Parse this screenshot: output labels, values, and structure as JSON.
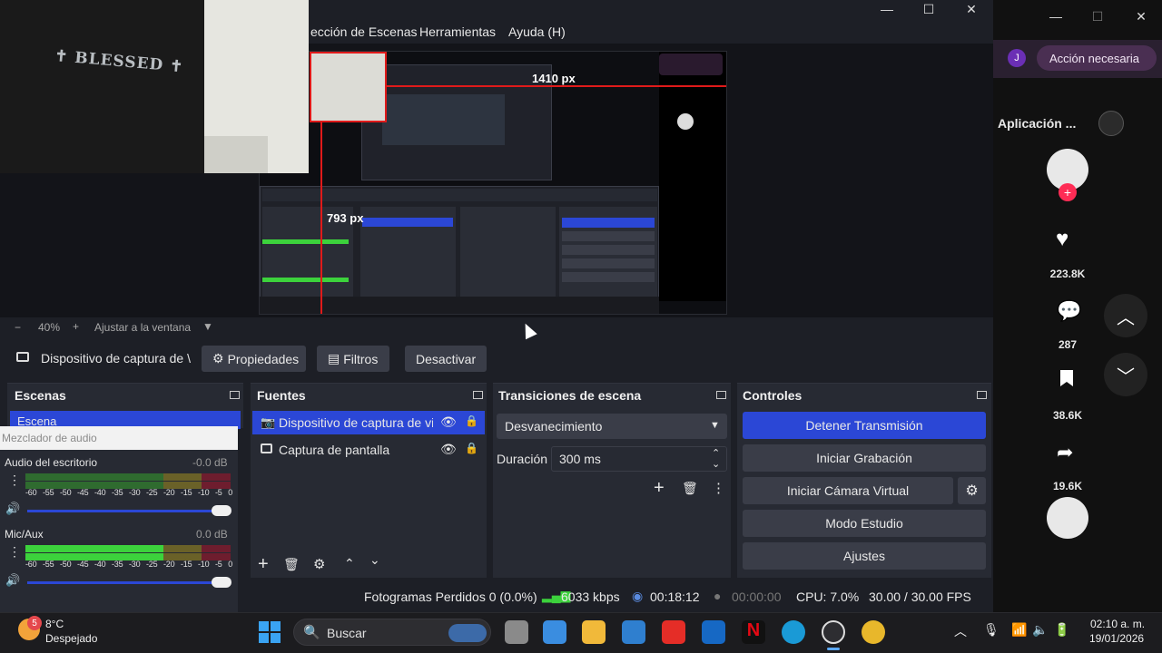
{
  "window": {
    "minimize": "—",
    "maximize": "☐",
    "close": "✕"
  },
  "menu": {
    "scene_collection": "ección de Escenas",
    "tools": "Herramientas",
    "help": "Ayuda (H)"
  },
  "preview": {
    "webcam_text": "✝ BLESSED ✝",
    "width_label": "1410 px",
    "height_label": "793 px"
  },
  "zoom": {
    "minus": "−",
    "level": "40%",
    "plus": "+",
    "fit": "Ajustar a la ventana"
  },
  "source_toolbar": {
    "source_name": "Dispositivo de captura de \\",
    "properties": "Propiedades",
    "filters": "Filtros",
    "deactivate": "Desactivar"
  },
  "scenes": {
    "title": "Escenas",
    "items": [
      "Escena"
    ]
  },
  "mixer": {
    "title": "Mezclador de audio",
    "channels": [
      {
        "name": "Audio del escritorio",
        "db": "-0.0 dB"
      },
      {
        "name": "Mic/Aux",
        "db": "0.0 dB"
      }
    ],
    "scale": [
      "-60",
      "-55",
      "-50",
      "-45",
      "-40",
      "-35",
      "-30",
      "-25",
      "-20",
      "-15",
      "-10",
      "-5",
      "0"
    ]
  },
  "sources": {
    "title": "Fuentes",
    "items": [
      {
        "label": "Dispositivo de captura de vic",
        "selected": true
      },
      {
        "label": "Captura de pantalla",
        "selected": false
      }
    ]
  },
  "transitions": {
    "title": "Transiciones de escena",
    "selected": "Desvanecimiento",
    "duration_label": "Duración",
    "duration_value": "300 ms"
  },
  "controls": {
    "title": "Controles",
    "stop_stream": "Detener Transmisión",
    "start_recording": "Iniciar Grabación",
    "start_virtual_cam": "Iniciar Cámara Virtual",
    "studio_mode": "Modo Estudio",
    "settings": "Ajustes"
  },
  "status": {
    "dropped_frames": "Fotogramas Perdidos 0 (0.0%)",
    "bitrate": "6033 kbps",
    "stream_time": "00:18:12",
    "record_time": "00:00:00",
    "cpu": "CPU: 7.0%",
    "fps": "30.00 / 30.00 FPS"
  },
  "browser": {
    "profile_initial": "J",
    "action_needed": "Acción necesaria",
    "app_label": "Aplicación ...",
    "likes": "223.8K",
    "comments": "287",
    "saves": "38.6K",
    "shares": "19.6K"
  },
  "taskbar": {
    "weather_temp": "8°C",
    "weather_desc": "Despejado",
    "weather_badge": "5",
    "search": "Buscar",
    "time": "02:10 a. m.",
    "date": "19/01/2026"
  },
  "colors": {
    "accent": "#2b47d6",
    "meter_green": "#3cd23c",
    "meter_yellow": "#b8a82a",
    "meter_red": "#b3223a",
    "tiktok_pink": "#fe2c55"
  }
}
